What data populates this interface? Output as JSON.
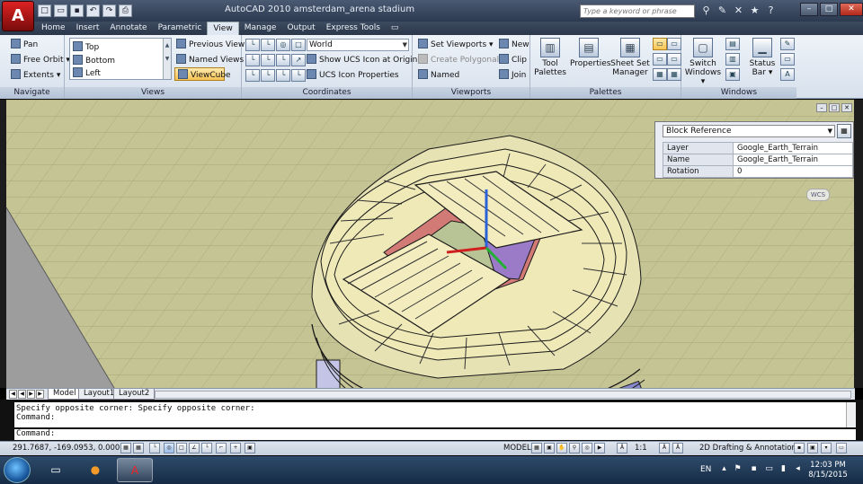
{
  "window": {
    "title": "AutoCAD 2010    amsterdam_arena stadium",
    "app_button": "A",
    "search_placeholder": "Type a keyword or phrase"
  },
  "tabs": [
    "Home",
    "Insert",
    "Annotate",
    "Parametric",
    "View",
    "Manage",
    "Output",
    "Express Tools"
  ],
  "active_tab": "View",
  "ribbon": {
    "navigate": {
      "title": "Navigate",
      "items": [
        "Pan",
        "Free Orbit",
        "Extents"
      ]
    },
    "views": {
      "title": "Views",
      "list": [
        "Top",
        "Bottom",
        "Left"
      ],
      "buttons": [
        "Previous View",
        "Named Views",
        "ViewCube"
      ]
    },
    "coordinates": {
      "title": "Coordinates",
      "combo": "World",
      "items": [
        "Show UCS Icon at Origin",
        "UCS Icon Properties"
      ]
    },
    "viewports": {
      "title": "Viewports",
      "items": [
        "Set Viewports",
        "Create Polygonal",
        "Named"
      ],
      "right_items": [
        "New",
        "Clip",
        "Join"
      ]
    },
    "palettes": {
      "title": "Palettes",
      "buttons": [
        "Tool Palettes",
        "Properties",
        "Sheet Set Manager"
      ]
    },
    "windows": {
      "title": "Windows",
      "buttons": [
        "Switch Windows",
        "Status Bar"
      ]
    }
  },
  "properties_palette": {
    "selection": "Block Reference",
    "rows": [
      {
        "key": "Layer",
        "value": "Google_Earth_Terrain"
      },
      {
        "key": "Name",
        "value": "Google_Earth_Terrain"
      },
      {
        "key": "Rotation",
        "value": "0"
      }
    ]
  },
  "viewport": {
    "wcs_label": "WCS"
  },
  "layout_tabs": [
    "Model",
    "Layout1",
    "Layout2"
  ],
  "active_layout": "Model",
  "command": {
    "history": [
      "Specify opposite corner: Specify opposite corner:",
      "Command:"
    ],
    "prompt": "Command:"
  },
  "status": {
    "coordinates": "291.7687, -169.0953, 0.0000",
    "model_label": "MODEL",
    "scale": "1:1",
    "workspace": "2D Drafting & Annotation"
  },
  "taskbar": {
    "language": "EN",
    "time": "12:03 PM",
    "date": "8/15/2015"
  },
  "colors": {
    "viewport_bg": "#c5c494",
    "ribbon_bg": "#dfe7f2",
    "title_bar": "#3a4860",
    "taskbar": "#1f3a5a"
  }
}
